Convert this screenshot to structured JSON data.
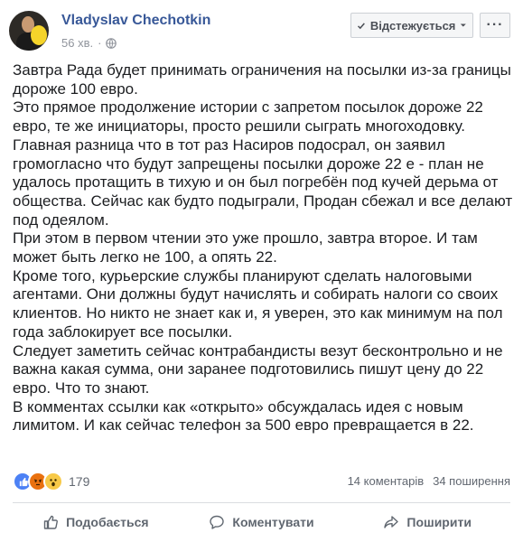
{
  "post": {
    "author": "Vladyslav Chechotkin",
    "time": "56 хв.",
    "follow_label": "Відстежується",
    "more_label": "···",
    "paragraphs": [
      "Завтра Рада будет принимать ограничения на посылки из-за границы дороже 100 евро.",
      "Это прямое продолжение истории с запретом посылок дороже 22 евро, те же инициаторы, просто решили сыграть многоходовку.",
      "Главная разница что в тот раз Насиров подосрал, он заявил громогласно что будут запрещены посылки дороже 22 е - план не удалось протащить в тихую и он был погребён под кучей дерьма от общества. Сейчас как будто подыграли, Продан сбежал и все делают под одеялом.",
      "При этом в первом чтении это уже прошло, завтра второе. И там может быть легко не 100, а опять 22.",
      "Кроме того, курьерские службы планируют сделать налоговыми агентами. Они должны будут начислять и собирать налоги со своих клиентов. Но никто не знает как и, я уверен, это как минимум на пол года заблокирует все посылки.",
      "Следует заметить сейчас контрабандисты везут бесконтрольно и не важна какая сумма, они заранее подготовились пишут цену до 22 евро. Что то знают.",
      "В комментах ссылки как «открыто» обсуждалась идея с новым лимитом. И как сейчас телефон за 500 евро превращается в 22."
    ]
  },
  "reactions": {
    "count": "179",
    "types": [
      "like",
      "angry",
      "wow"
    ]
  },
  "stats": {
    "comments": "14 коментарів",
    "shares": "34 поширення"
  },
  "actions": {
    "like": "Подобається",
    "comment": "Коментувати",
    "share": "Поширити"
  },
  "colors": {
    "author_link": "#385898",
    "meta_gray": "#90949c",
    "like_blue": "#4c81f5",
    "angry_orange": "#e9710f",
    "wow_yellow": "#f7c948"
  }
}
